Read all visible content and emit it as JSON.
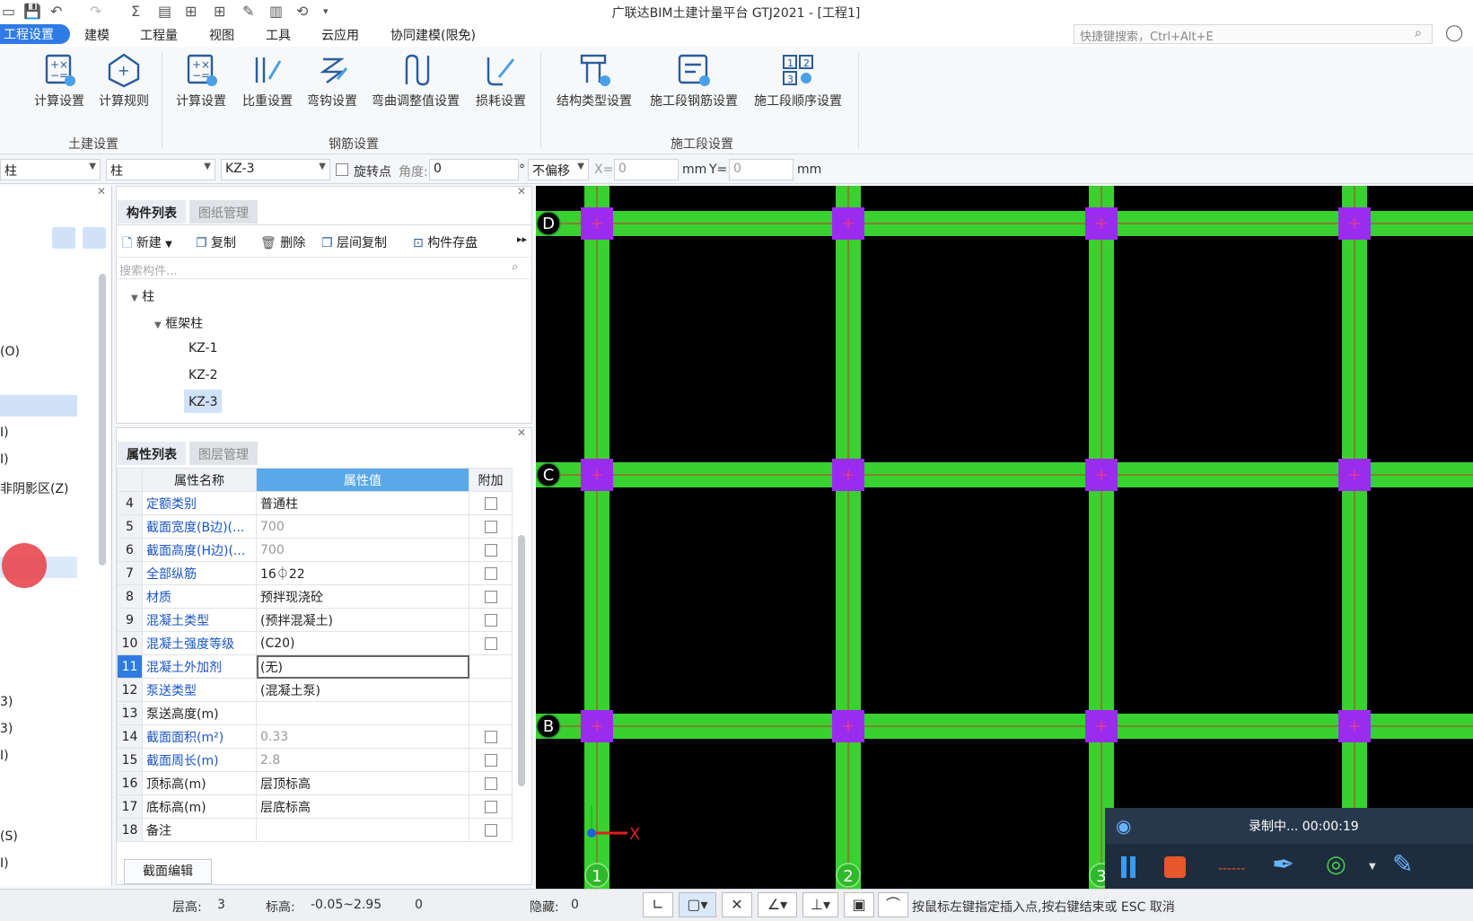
{
  "window": {
    "title": "广联达BIM土建计量平台 GTJ2021 - [工程1]"
  },
  "menu": {
    "items": [
      "工程设置",
      "建模",
      "工程量",
      "视图",
      "工具",
      "云应用",
      "协同建模(限免)"
    ],
    "search_placeholder": "快捷键搜索，Ctrl+Alt+E"
  },
  "ribbon": {
    "buttons": [
      "计算设置",
      "计算规则",
      "计算设置",
      "比重设置",
      "弯钩设置",
      "弯曲调整值设置",
      "损耗设置",
      "结构类型设置",
      "施工段钢筋设置",
      "施工段顺序设置"
    ],
    "groups": [
      "土建设置",
      "钢筋设置",
      "施工段设置"
    ]
  },
  "toolbar": {
    "combo1": "柱",
    "combo2": "柱",
    "combo3": "KZ-3",
    "rotate_label": "旋转点",
    "angle_label": "角度:",
    "angle_value": "0",
    "deg": "°",
    "offset": "不偏移",
    "x_label": "X=",
    "x_value": "0",
    "mm1": "mm",
    "y_label": "Y=",
    "y_value": "0",
    "mm2": "mm"
  },
  "left": {
    "items": [
      "(O)",
      "I)",
      "I)",
      "非阴影区(Z)",
      "3)",
      "3)",
      "I)",
      "(S)",
      "I)"
    ]
  },
  "component": {
    "tabs": [
      "构件列表",
      "图纸管理"
    ],
    "actions": [
      "新建",
      "复制",
      "删除",
      "层间复制",
      "构件存盘"
    ],
    "search_placeholder": "搜索构件...",
    "tree": {
      "root": "柱",
      "group": "框架柱",
      "items": [
        "KZ-1",
        "KZ-2",
        "KZ-3"
      ]
    }
  },
  "props": {
    "tabs": [
      "属性列表",
      "图层管理"
    ],
    "headers": [
      "属性名称",
      "属性值",
      "附加"
    ],
    "rows": [
      {
        "n": "4",
        "name": "定额类别",
        "val": "普通柱",
        "chk": true
      },
      {
        "n": "5",
        "name": "截面宽度(B边)(...",
        "val": "700",
        "chk": true
      },
      {
        "n": "6",
        "name": "截面高度(H边)(...",
        "val": "700",
        "chk": true
      },
      {
        "n": "7",
        "name": "全部纵筋",
        "val": "16⏀22",
        "chk": true
      },
      {
        "n": "8",
        "name": "材质",
        "val": "预拌现浇砼",
        "chk": true
      },
      {
        "n": "9",
        "name": "混凝土类型",
        "val": "(预拌混凝土)",
        "chk": true
      },
      {
        "n": "10",
        "name": "混凝土强度等级",
        "val": "(C20)",
        "chk": true
      },
      {
        "n": "11",
        "name": "混凝土外加剂",
        "val": "(无)",
        "chk": false
      },
      {
        "n": "12",
        "name": "泵送类型",
        "val": "(混凝土泵)",
        "chk": false
      },
      {
        "n": "13",
        "name": "泵送高度(m)",
        "val": "",
        "chk": false
      },
      {
        "n": "14",
        "name": "截面面积(m²)",
        "val": "0.33",
        "chk": true
      },
      {
        "n": "15",
        "name": "截面周长(m)",
        "val": "2.8",
        "chk": true
      },
      {
        "n": "16",
        "name": "顶标高(m)",
        "val": "层顶标高",
        "chk": true
      },
      {
        "n": "17",
        "name": "底标高(m)",
        "val": "层底标高",
        "chk": true
      },
      {
        "n": "18",
        "name": "备注",
        "val": "",
        "chk": true
      }
    ],
    "section_edit": "截面编辑"
  },
  "canvas": {
    "axes_rows": [
      "D",
      "C",
      "B"
    ],
    "axes_cols": [
      "1",
      "2",
      "3"
    ],
    "x_axis": "X"
  },
  "status": {
    "floor_label": "层高:",
    "floor": "3",
    "elev_label": "标高:",
    "elev": "-0.05~2.95",
    "zero": "0",
    "hide_label": "隐藏:",
    "hide": "0",
    "hint": "按鼠标左键指定插入点,按右键结束或 ESC 取消"
  },
  "recorder": {
    "text": "录制中... 00:00:19",
    "dashes": "------"
  },
  "colors": {
    "accent": "#2f7be6",
    "beam": "#39d12f",
    "column": "#9a2cf0"
  }
}
